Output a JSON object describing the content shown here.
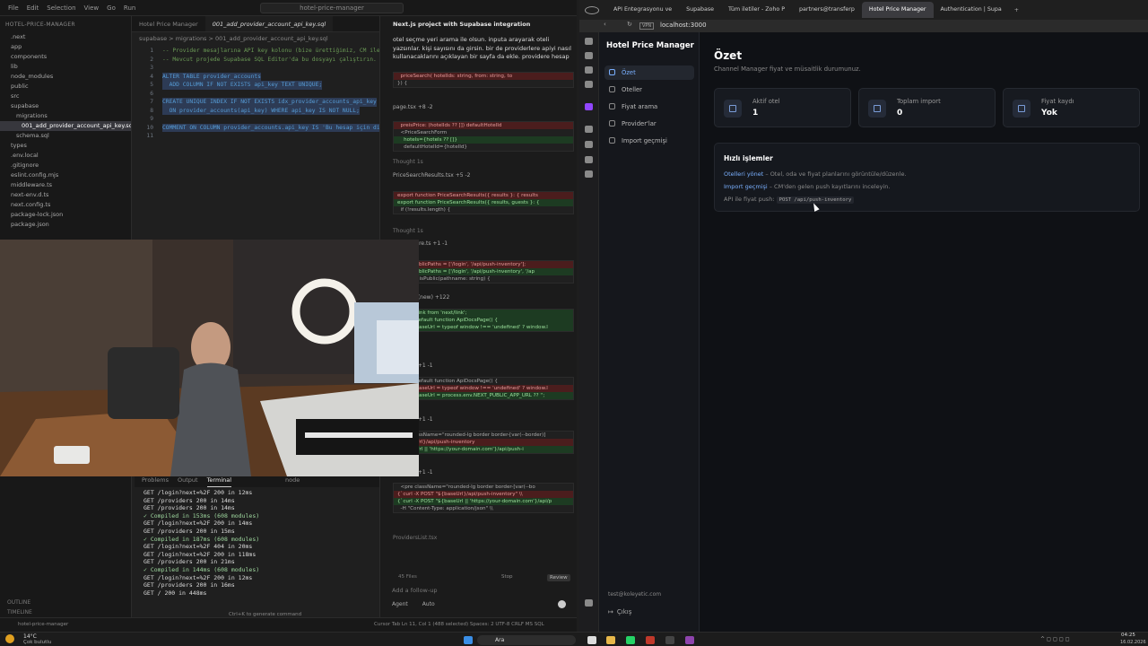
{
  "ide": {
    "menu": [
      "File",
      "Edit",
      "Selection",
      "View",
      "Go",
      "Run"
    ],
    "workspace": "hotel-price-manager",
    "explorer_header": "HOTEL-PRICE-MANAGER",
    "tree": [
      ".next",
      "app",
      "components",
      "lib",
      "node_modules",
      "public",
      "src",
      "supabase",
      "migrations",
      "001_add_provider_account_api_key.sql",
      "schema.sql",
      "types",
      ".env.local",
      ".gitignore",
      "eslint.config.mjs",
      "middleware.ts",
      "next-env.d.ts",
      "next.config.ts",
      "package-lock.json",
      "package.json"
    ],
    "outline": "OUTLINE",
    "timeline": "TIMELINE",
    "tabs": [
      "Hotel Price Manager",
      "001_add_provider_account_api_key.sql"
    ],
    "breadcrumb": "supabase > migrations > 001_add_provider_account_api_key.sql",
    "code_lines": [
      {
        "n": "1",
        "t": "-- Provider mesajlarına API key kolonu (bize ürettiğimiz, CM ile...",
        "c": "c-cm"
      },
      {
        "n": "2",
        "t": "-- Mevcut projede Supabase SQL Editor'da bu dosyayı çalıştırın.",
        "c": "c-cm"
      },
      {
        "n": "3",
        "t": "",
        "c": "c-tx"
      },
      {
        "n": "4",
        "t": "ALTER TABLE provider_accounts",
        "c": "c-kw"
      },
      {
        "n": "5",
        "t": "  ADD COLUMN IF NOT EXISTS api_key TEXT UNIQUE;",
        "c": "c-kw"
      },
      {
        "n": "6",
        "t": "",
        "c": "c-tx"
      },
      {
        "n": "7",
        "t": "CREATE UNIQUE INDEX IF NOT EXISTS idx_provider_accounts_api_key",
        "c": "c-kw"
      },
      {
        "n": "8",
        "t": "  ON provider_accounts(api_key) WHERE api_key IS NOT NULL;",
        "c": "c-kw"
      },
      {
        "n": "9",
        "t": "",
        "c": "c-tx"
      },
      {
        "n": "10",
        "t": "COMMENT ON COLUMN provider_accounts.api_key IS 'Bu hesap için di",
        "c": "c-kw"
      },
      {
        "n": "11",
        "t": "",
        "c": "c-tx"
      }
    ],
    "terminal_tabs": [
      "Problems",
      "Output",
      "Terminal"
    ],
    "terminal_shell": "node",
    "terminal_lines": [
      {
        "t": "GET /login?next=%2F 200 in 12ms",
        "ok": false
      },
      {
        "t": "GET /providers 200 in 14ms",
        "ok": false
      },
      {
        "t": "GET /providers 200 in 14ms",
        "ok": false
      },
      {
        "t": "✓ Compiled in 153ms (608 modules)",
        "ok": true
      },
      {
        "t": "GET /login?next=%2F 200 in 14ms",
        "ok": false
      },
      {
        "t": "GET /providers 200 in 15ms",
        "ok": false
      },
      {
        "t": "✓ Compiled in 187ms (608 modules)",
        "ok": true
      },
      {
        "t": "GET /login?next=%2F 404 in 20ms",
        "ok": false
      },
      {
        "t": "GET /login?next=%2F 200 in 118ms",
        "ok": false
      },
      {
        "t": "GET /providers 200 in 21ms",
        "ok": false
      },
      {
        "t": "✓ Compiled in 144ms (608 modules)",
        "ok": true
      },
      {
        "t": "GET /login?next=%2F 200 in 12ms",
        "ok": false
      },
      {
        "t": "GET /providers 200 in 16ms",
        "ok": false
      },
      {
        "t": "GET / 200 in 448ms",
        "ok": false
      }
    ],
    "terminal_hint": "Ctrl+K to generate command",
    "status_left": "hotel-price-manager",
    "status_right": "Cursor Tab   Ln 11, Col 1 (488 selected)   Spaces: 2   UTF-8   CRLF   MS SQL"
  },
  "agent": {
    "title": "Next.js project with Supabase integration",
    "message": "otel seçme yeri arama ile olsun. inputa arayarak oteli yazsınlar. kişi sayısını da girsin. bir de providerlere apiyi nasıl kullanacaklarını açıklayan bir sayfa da ekle. providere hesap",
    "file1": "page.tsx  +8 -2",
    "thought1": "Thought 1s",
    "file2": "PriceSearchResults.tsx  +5 -2",
    "thought2": "Thought 1s",
    "file3": "middleware.ts  +1 -1",
    "file4": "page.tsx (new)  +122",
    "file5": "page.tsx  +1 -1",
    "file6": "page.tsx  +1 -1",
    "file7": "page.tsx  +1 -1",
    "pending": "ProvidersList.tsx",
    "files_count": "45 Files",
    "stop": "Stop",
    "review": "Review",
    "follow_placeholder": "Add a follow-up",
    "mode": "Agent",
    "model": "Auto",
    "diff1": [
      {
        "k": "del",
        "t": "  preisPrice: (hotelIds ?? []) defaultHotelId"
      },
      {
        "k": "plain",
        "t": "  <PriceSearchForm"
      },
      {
        "k": "add",
        "t": "    hotels={hotels ?? []}"
      },
      {
        "k": "plain",
        "t": "    defaultHotelId={hotelId}"
      }
    ],
    "diff2": [
      {
        "k": "del",
        "t": "export function PriceSearchResults({ results }: { results"
      },
      {
        "k": "add",
        "t": "export function PriceSearchResults({ results, guests }: {"
      },
      {
        "k": "plain",
        "t": "  if (!results.length) {"
      }
    ],
    "diff3": [
      {
        "k": "del",
        "t": "const publicPaths = ['/login', '/api/push-inventory'];"
      },
      {
        "k": "add",
        "t": "const publicPaths = ['/login', '/api/push-inventory', '/ap"
      },
      {
        "k": "plain",
        "t": "function isPublic(pathname: string) {"
      }
    ],
    "diff4": [
      {
        "k": "add",
        "t": "import Link from 'next/link';"
      },
      {
        "k": "plain",
        "t": ""
      },
      {
        "k": "add",
        "t": "export default function ApiDocsPage() {"
      },
      {
        "k": "add",
        "t": "  const baseUrl = typeof window !== 'undefined' ? window.l"
      }
    ],
    "diff5": [
      {
        "k": "plain",
        "t": "export default function ApiDocsPage() {"
      },
      {
        "k": "del",
        "t": "  const baseUrl = typeof window !== 'undefined' ? window.l"
      },
      {
        "k": "add",
        "t": "  const baseUrl = process.env.NEXT_PUBLIC_APP_URL ?? '';"
      }
    ],
    "diff6": [
      {
        "k": "plain",
        "t": "<div className=\"rounded-lg border border-[var(--border)]"
      },
      {
        "k": "del",
        "t": "  {baseUrl}/api/push-inventory"
      },
      {
        "k": "add",
        "t": "  {baseUrl || 'https://your-domain.com'}/api/push-i"
      }
    ],
    "diff7": [
      {
        "k": "plain",
        "t": "  <pre className=\"rounded-lg border border-[var(--bo"
      },
      {
        "k": "del",
        "t": "{`curl -X POST \"${baseUrl}/api/push-inventory\" \\\\"
      },
      {
        "k": "add",
        "t": "{`curl -X POST \"${baseUrl || 'https://your-domain.com'}/api/p"
      },
      {
        "k": "plain",
        "t": "  -H \"Content-Type: application/json\" \\\\"
      }
    ]
  },
  "browser": {
    "tabs": [
      "API Entegrasyonu ve",
      "Supabase",
      "Tüm iletiler - Zoho P",
      "partners@transferp",
      "Hotel Price Manager",
      "Authentication | Supa"
    ],
    "active_tab": 4,
    "url": "localhost:3000"
  },
  "app": {
    "brand": "Hotel Price Manager",
    "nav": [
      "Özet",
      "Oteller",
      "Fiyat arama",
      "Provider'lar",
      "Import geçmişi"
    ],
    "active_nav": 0,
    "user_email": "test@koleyetic.com",
    "logout": "Çıkış",
    "title": "Özet",
    "subtitle": "Channel Manager fiyat ve müsaitlik durumunuz.",
    "cards": [
      {
        "label": "Aktif otel",
        "value": "1"
      },
      {
        "label": "Toplam import",
        "value": "0"
      },
      {
        "label": "Fiyat kaydı",
        "value": "Yok"
      }
    ],
    "quick": {
      "title": "Hızlı işlemler",
      "row1_link": "Otelleri yönet",
      "row1_text": " – Otel, oda ve fiyat planlarını görüntüle/düzenle.",
      "row2_link": "Import geçmişi",
      "row2_text": " – CM'den gelen push kayıtlarını inceleyin.",
      "row3_text": "API ile fiyat push: ",
      "row3_code": "POST /api/push-inventory"
    }
  },
  "taskbar": {
    "weather_temp": "14°C",
    "weather_text": "Çok bulutlu",
    "search": "Ara",
    "time": "04:25",
    "date": "16.02.2026"
  },
  "colors": {
    "accent": "#7ab0ff",
    "app_bg": "#0f1115",
    "ide_bg": "#1f1f1f"
  }
}
